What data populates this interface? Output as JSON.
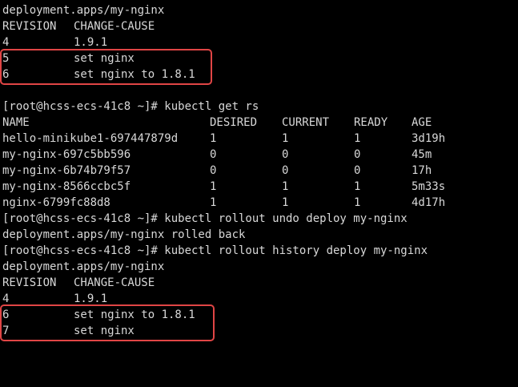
{
  "terminal": {
    "top_partial": "                                                       ",
    "history1": {
      "deployment_line": "deployment.apps/my-nginx",
      "header": {
        "revision": "REVISION",
        "change_cause": "CHANGE-CAUSE"
      },
      "rows": [
        {
          "revision": "4",
          "change_cause": "1.9.1"
        },
        {
          "revision": "5",
          "change_cause": "set nginx"
        },
        {
          "revision": "6",
          "change_cause": "set nginx to 1.8.1"
        }
      ]
    },
    "get_rs": {
      "command": "[root@hcss-ecs-41c8 ~]# kubectl get rs",
      "headers": {
        "name": "NAME",
        "desired": "DESIRED",
        "current": "CURRENT",
        "ready": "READY",
        "age": "AGE"
      },
      "rows": [
        {
          "name": "hello-minikube1-697447879d",
          "desired": "1",
          "current": "1",
          "ready": "1",
          "age": "3d19h"
        },
        {
          "name": "my-nginx-697c5bb596",
          "desired": "0",
          "current": "0",
          "ready": "0",
          "age": "45m"
        },
        {
          "name": "my-nginx-6b74b79f57",
          "desired": "0",
          "current": "0",
          "ready": "0",
          "age": "17h"
        },
        {
          "name": "my-nginx-8566ccbc5f",
          "desired": "1",
          "current": "1",
          "ready": "1",
          "age": "5m33s"
        },
        {
          "name": "nginx-6799fc88d8",
          "desired": "1",
          "current": "1",
          "ready": "1",
          "age": "4d17h"
        }
      ]
    },
    "undo": {
      "command": "[root@hcss-ecs-41c8 ~]# kubectl rollout undo deploy my-nginx",
      "output": "deployment.apps/my-nginx rolled back"
    },
    "history2": {
      "command": "[root@hcss-ecs-41c8 ~]# kubectl rollout history deploy my-nginx",
      "deployment_line": "deployment.apps/my-nginx",
      "header": {
        "revision": "REVISION",
        "change_cause": "CHANGE-CAUSE"
      },
      "rows": [
        {
          "revision": "4",
          "change_cause": "1.9.1"
        },
        {
          "revision": "6",
          "change_cause": "set nginx to 1.8.1"
        },
        {
          "revision": "7",
          "change_cause": "set nginx"
        }
      ]
    },
    "colors": {
      "background": "#000000",
      "text": "#d8d8d8",
      "highlight_border": "#e04545"
    }
  }
}
